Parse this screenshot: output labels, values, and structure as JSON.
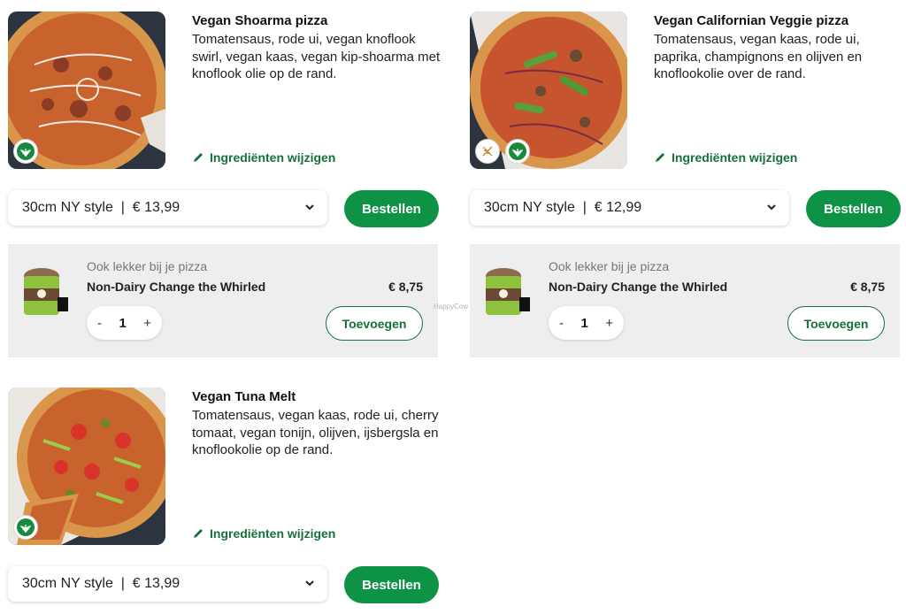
{
  "products": [
    {
      "title": "Vegan Shoarma pizza",
      "description": "Tomatensaus, rode ui, vegan knoflook swirl, vegan kaas, vegan kip-shoarma met knoflook olie op de rand.",
      "edit_label": "Ingrediënten wijzigen",
      "size_option": "30cm NY style  |  € 13,99",
      "order_label": "Bestellen",
      "badges": [
        "vegan-icon"
      ]
    },
    {
      "title": "Vegan Californian Veggie pizza",
      "description": "Tomatensaus, vegan kaas, rode ui, paprika, champignons en olijven en knoflookolie over de rand.",
      "edit_label": "Ingrediënten wijzigen",
      "size_option": "30cm NY style  |  € 12,99",
      "order_label": "Bestellen",
      "badges": [
        "wheat-icon",
        "vegan-icon"
      ]
    },
    {
      "title": "Vegan Tuna Melt",
      "description": "Tomatensaus, vegan kaas, rode ui, cherry tomaat, vegan tonijn, olijven, ijsbergsla en knoflookolie op de rand.",
      "edit_label": "Ingrediënten wijzigen",
      "size_option": "30cm NY style  |  € 13,99",
      "order_label": "Bestellen",
      "badges": [
        "vegan-icon"
      ]
    }
  ],
  "upsells": [
    {
      "caption": "Ook lekker bij je pizza",
      "name": "Non-Dairy Change the Whirled",
      "price": "€ 8,75",
      "quantity": "1",
      "minus": "-",
      "plus": "+",
      "add_label": "Toevoegen"
    },
    {
      "caption": "Ook lekker bij je pizza",
      "name": "Non-Dairy Change the Whirled",
      "price": "€ 8,75",
      "quantity": "1",
      "minus": "-",
      "plus": "+",
      "add_label": "Toevoegen"
    }
  ],
  "watermark": "HappyCow",
  "colors": {
    "brand_green": "#0d9246",
    "link_green": "#17703a",
    "panel_bg": "#eeeeee"
  }
}
